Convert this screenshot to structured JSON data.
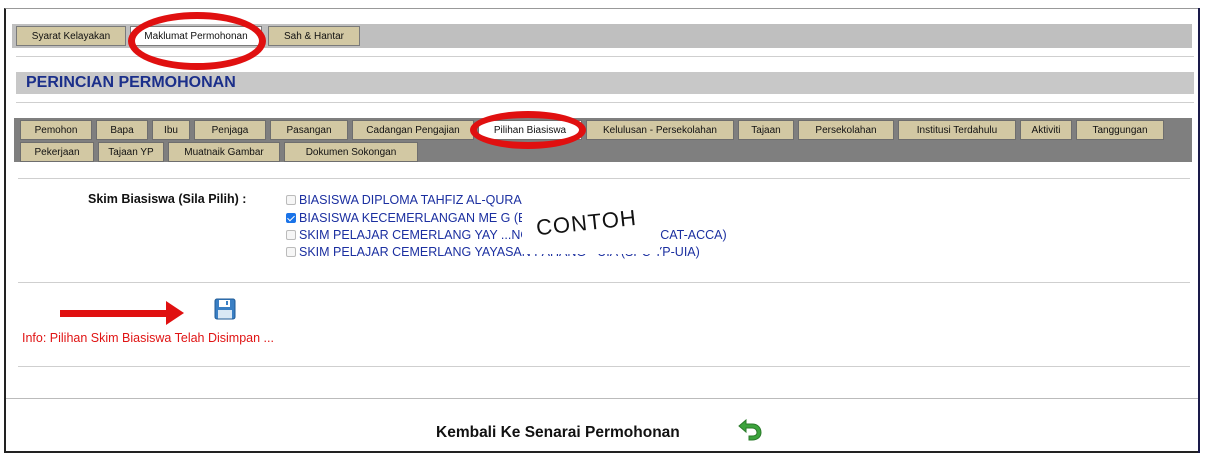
{
  "top_tabs": [
    {
      "label": "Syarat Kelayakan"
    },
    {
      "label": "Maklumat Permohonan",
      "active": true
    },
    {
      "label": "Sah & Hantar"
    }
  ],
  "section_title": "PERINCIAN PERMOHONAN",
  "sub_tabs_row1": [
    {
      "label": "Pemohon"
    },
    {
      "label": "Bapa"
    },
    {
      "label": "Ibu"
    },
    {
      "label": "Penjaga"
    },
    {
      "label": "Pasangan"
    },
    {
      "label": "Cadangan Pengajian"
    },
    {
      "label": "Pilihan Biasiswa",
      "active": true
    },
    {
      "label": "Kelulusan - Persekolahan"
    },
    {
      "label": "Tajaan"
    },
    {
      "label": "Persekolahan"
    },
    {
      "label": "Institusi Terdahulu"
    },
    {
      "label": "Aktiviti"
    },
    {
      "label": "Tanggungan"
    }
  ],
  "sub_tabs_row2": [
    {
      "label": "Pekerjaan"
    },
    {
      "label": "Tajaan YP"
    },
    {
      "label": "Muatnaik Gambar"
    },
    {
      "label": "Dokumen Sokongan"
    }
  ],
  "skim": {
    "label": "Skim Biasiswa (Sila Pilih)  :",
    "options": [
      {
        "text": "BIASISWA DIPLOMA TAHFIZ AL-QURAN WA...                         MTNP",
        "checked": false
      },
      {
        "text": "BIASISWA KECEMERLANGAN ME                                         G (BKMB)",
        "checked": true
      },
      {
        "text": "SKIM PELAJAR CEMERLANG YAY                     ...NG - CAT-ACCA (SPC YP-CAT-ACCA)",
        "checked": false
      },
      {
        "text": "SKIM PELAJAR CEMERLANG YAYASAN PAHANG - UIA (SPC YP-UIA)",
        "checked": false
      }
    ]
  },
  "watermark": "CONTOH",
  "info": "Info: Pilihan Skim Biasiswa Telah Disimpan ...",
  "back_label": "Kembali Ke Senarai Permohonan",
  "colors": {
    "accent_red": "#e01010",
    "title_blue": "#1b2f8a",
    "tab_bg": "#d2c8a3"
  }
}
